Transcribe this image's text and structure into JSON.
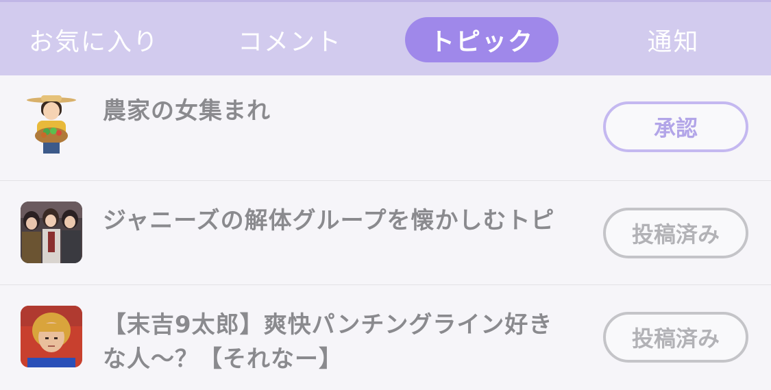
{
  "tabs": [
    {
      "label": "お気に入り",
      "active": false
    },
    {
      "label": "コメント",
      "active": false
    },
    {
      "label": "トピック",
      "active": true
    },
    {
      "label": "通知",
      "active": false
    }
  ],
  "topics": [
    {
      "title": "農家の女集まれ",
      "action": "承認",
      "thumb": "farmer-woman-illustration"
    },
    {
      "title": "ジャニーズの解体グループを懐かしむトピ",
      "action": "投稿済み",
      "thumb": "group-photo"
    },
    {
      "title": "【末吉9太郎】爽快パンチングライン好きな人〜？【それなー】",
      "action": "投稿済み",
      "thumb": "person-photo"
    }
  ],
  "colors": {
    "tab_bar": "#d2cbee",
    "tab_active": "#9f88ea",
    "approve_border": "#c4b8f0",
    "posted_border": "#c4c4c8"
  }
}
